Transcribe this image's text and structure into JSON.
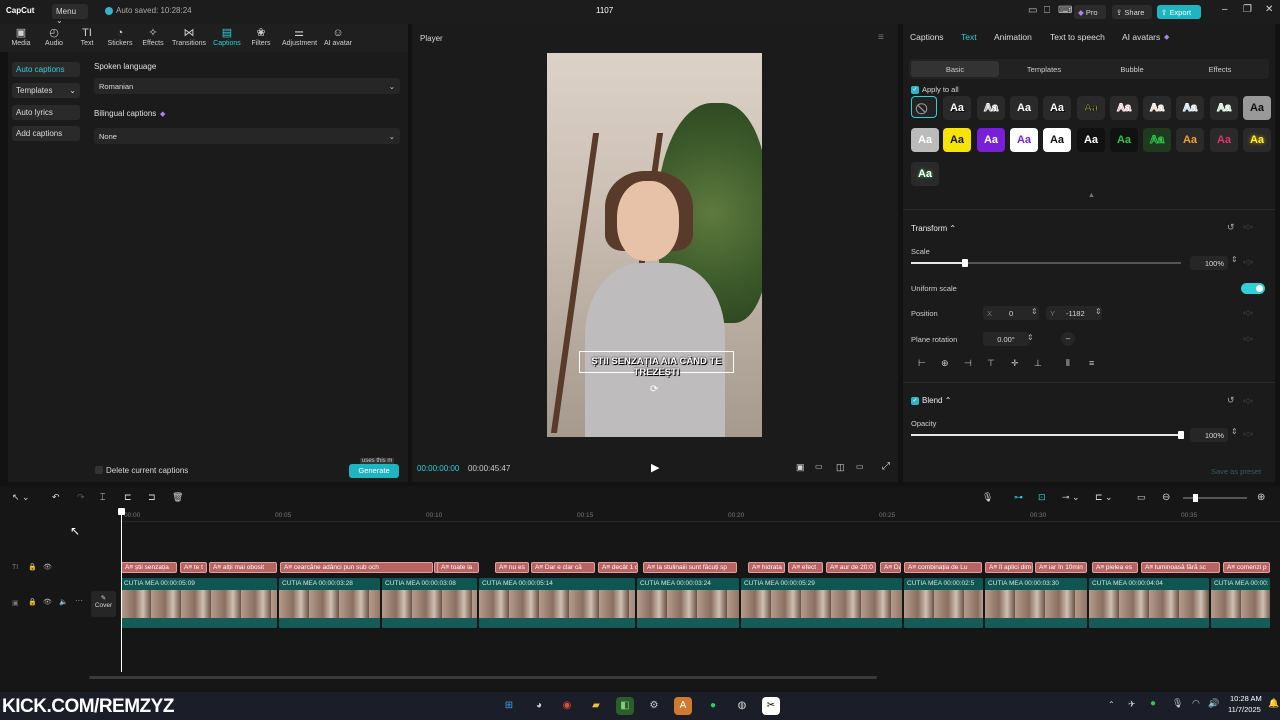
{
  "titlebar": {
    "logo": "CapCut",
    "menu": "Menu",
    "autosave": "Auto saved: 10:28:24",
    "project": "1107",
    "pro": "Pro",
    "share": "Share",
    "export": "Export"
  },
  "toolbar": {
    "tools": [
      "Media",
      "Audio",
      "Text",
      "Stickers",
      "Effects",
      "Transitions",
      "Captions",
      "Filters",
      "Adjustment",
      "AI avatar"
    ],
    "active": "Captions"
  },
  "leftnav": {
    "items": [
      "Auto captions",
      "Templates",
      "Auto lyrics",
      "Add captions"
    ]
  },
  "captions_panel": {
    "spoken_language_label": "Spoken language",
    "spoken_language_value": "Romanian",
    "bilingual_label": "Bilingual captions",
    "bilingual_value": "None",
    "delete_label": "Delete current captions",
    "generate": "Generate",
    "generate_tip": "uses this m"
  },
  "player": {
    "title": "Player",
    "caption_text": "ȘTII SENZAȚIA AIA CÂND TE TREZEȘTI",
    "time_current": "00:00:00:00",
    "time_total": "00:00:45:47"
  },
  "right": {
    "tabs": [
      "Captions",
      "Text",
      "Animation",
      "Text to speech",
      "AI avatars"
    ],
    "active_tab": "Text",
    "subtabs": [
      "Basic",
      "Templates",
      "Bubble",
      "Effects"
    ],
    "apply_all": "Apply to all",
    "style_glyph": "Aa",
    "transform": "Transform",
    "scale_label": "Scale",
    "scale_value": "100%",
    "scale_level": 1.0,
    "uniform_scale": "Uniform scale",
    "position_label": "Position",
    "pos_x_label": "X",
    "pos_x": "0",
    "pos_y_label": "Y",
    "pos_y": "-1182",
    "rotation_label": "Plane rotation",
    "rotation": "0.00°",
    "blend": "Blend",
    "opacity_label": "Opacity",
    "opacity_value": "100%",
    "opacity_level": 1.0,
    "save_preset": "Save as preset"
  },
  "timeline": {
    "ticks": [
      "00:00",
      "00:05",
      "00:10",
      "00:15",
      "00:20",
      "00:25",
      "00:30",
      "00:35"
    ],
    "cover": "Cover",
    "captions": [
      "știi senzația",
      "te t",
      "alții mai obosit",
      "cearcăne adânci pun sub och",
      "machiaj ca",
      "toate la",
      "nu es",
      "Dar e clar că",
      "decât 1 c",
      "la stulinaiii sunt făcuți sp",
      "hidrata",
      "efect",
      "aur de 20:0",
      "Dar",
      "combinația de Lu",
      "îl aplici dim",
      "iar în 10min",
      "pielea es",
      "luminoasă fără sc",
      "comenzi p"
    ],
    "clips": [
      {
        "name": "CUTIA MEA",
        "dur": "00:00:05:09"
      },
      {
        "name": "CUTIA MEA",
        "dur": "00:00:03:28"
      },
      {
        "name": "CUTIA MEA",
        "dur": "00:00:03:08"
      },
      {
        "name": "CUTIA MEA",
        "dur": "00:00:05:14"
      },
      {
        "name": "CUTIA MEA",
        "dur": "00:00:03:24"
      },
      {
        "name": "CUTIA MEA",
        "dur": "00:00:05:29"
      },
      {
        "name": "CUTIA MEA",
        "dur": "00:00:02:5"
      },
      {
        "name": "CUTIA MEA",
        "dur": "00:00:03:30"
      },
      {
        "name": "CUTIA MEA",
        "dur": "00:00:04:04"
      },
      {
        "name": "CUTIA MEA",
        "dur": "00:00:"
      }
    ]
  },
  "taskbar": {
    "watermark": "KICK.COM/REMZYZ",
    "time": "10:28 AM",
    "date": "11/7/2025"
  }
}
